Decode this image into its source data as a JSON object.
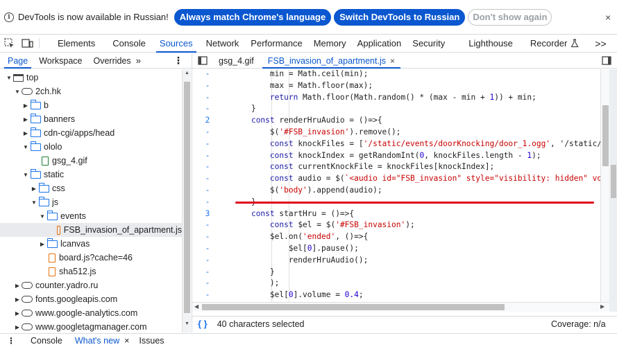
{
  "infobar": {
    "message": "DevTools is now available in Russian!",
    "match_language": "Always match Chrome's language",
    "switch_language": "Switch DevTools to Russian",
    "dont_show": "Don't show again"
  },
  "main_tabs": [
    "Elements",
    "Console",
    "Sources",
    "Network",
    "Performance",
    "Memory",
    "Application",
    "Security",
    "Lighthouse",
    "Recorder"
  ],
  "more_tabs": ">>",
  "nav_tabs": [
    "Page",
    "Workspace",
    "Overrides"
  ],
  "tree": [
    {
      "label": "top",
      "icon": "frame"
    },
    {
      "label": "2ch.hk",
      "icon": "cloud"
    },
    {
      "label": "b",
      "icon": "folder"
    },
    {
      "label": "banners",
      "icon": "folder"
    },
    {
      "label": "cdn-cgi/apps/head",
      "icon": "folder"
    },
    {
      "label": "ololo",
      "icon": "folder"
    },
    {
      "label": "gsg_4.gif",
      "icon": "file-green"
    },
    {
      "label": "static",
      "icon": "folder"
    },
    {
      "label": "css",
      "icon": "folder"
    },
    {
      "label": "js",
      "icon": "folder"
    },
    {
      "label": "events",
      "icon": "folder"
    },
    {
      "label": "FSB_invasion_of_apartment.js",
      "icon": "file"
    },
    {
      "label": "lcanvas",
      "icon": "folder"
    },
    {
      "label": "board.js?cache=46",
      "icon": "file"
    },
    {
      "label": "sha512.js",
      "icon": "file"
    },
    {
      "label": "counter.yadro.ru",
      "icon": "cloud"
    },
    {
      "label": "fonts.googleapis.com",
      "icon": "cloud"
    },
    {
      "label": "www.google-analytics.com",
      "icon": "cloud"
    },
    {
      "label": "www.googletagmanager.com",
      "icon": "cloud"
    }
  ],
  "editor_tabs": [
    {
      "label": "gsg_4.gif"
    },
    {
      "label": "FSB_invasion_of_apartment.js",
      "close": "×"
    }
  ],
  "code_lines": [
    {
      "g": "-",
      "t": "        min = Math.ceil(min);"
    },
    {
      "g": "-",
      "t": "        max = Math.floor(max);"
    },
    {
      "g": "-",
      "t": "        return Math.floor(Math.random() * (max - min + 1)) + min;"
    },
    {
      "g": "-",
      "t": "    }"
    },
    {
      "g": "2",
      "t": "    const renderHruAudio = ()=>{"
    },
    {
      "g": "-",
      "t": "        $('#FSB_invasion').remove();"
    },
    {
      "g": "-",
      "t": "        const knockFiles = ['/static/events/doorKnocking/door_1.ogg', '/static/e"
    },
    {
      "g": "-",
      "t": "        const knockIndex = getRandomInt(0, knockFiles.length - 1);"
    },
    {
      "g": "-",
      "t": "        const currentKnockFile = knockFiles[knockIndex];"
    },
    {
      "g": "-",
      "t": "        const audio = $(`<audio id=\"FSB_invasion\" style=\"visibility: hidden\" vol"
    },
    {
      "g": "-",
      "t": "        $('body').append(audio);"
    },
    {
      "g": "-",
      "t": "    }"
    },
    {
      "g": "3",
      "t": "    const startHru = ()=>{"
    },
    {
      "g": "-",
      "t": "        const $el = $('#FSB_invasion');"
    },
    {
      "g": "-",
      "t": "        $el.on('ended', ()=>{"
    },
    {
      "g": "-",
      "t": "            $el[0].pause();"
    },
    {
      "g": "-",
      "t": "            renderHruAudio();"
    },
    {
      "g": "-",
      "t": "        }"
    },
    {
      "g": "-",
      "t": "        );"
    },
    {
      "g": "-",
      "t": "        $el[0].volume = 0.4;"
    }
  ],
  "status": {
    "braces": "{ }",
    "selection": "40 characters selected",
    "coverage": "Coverage: n/a"
  },
  "drawer": {
    "console": "Console",
    "whats_new": "What's new",
    "close": "×",
    "issues": "Issues"
  }
}
